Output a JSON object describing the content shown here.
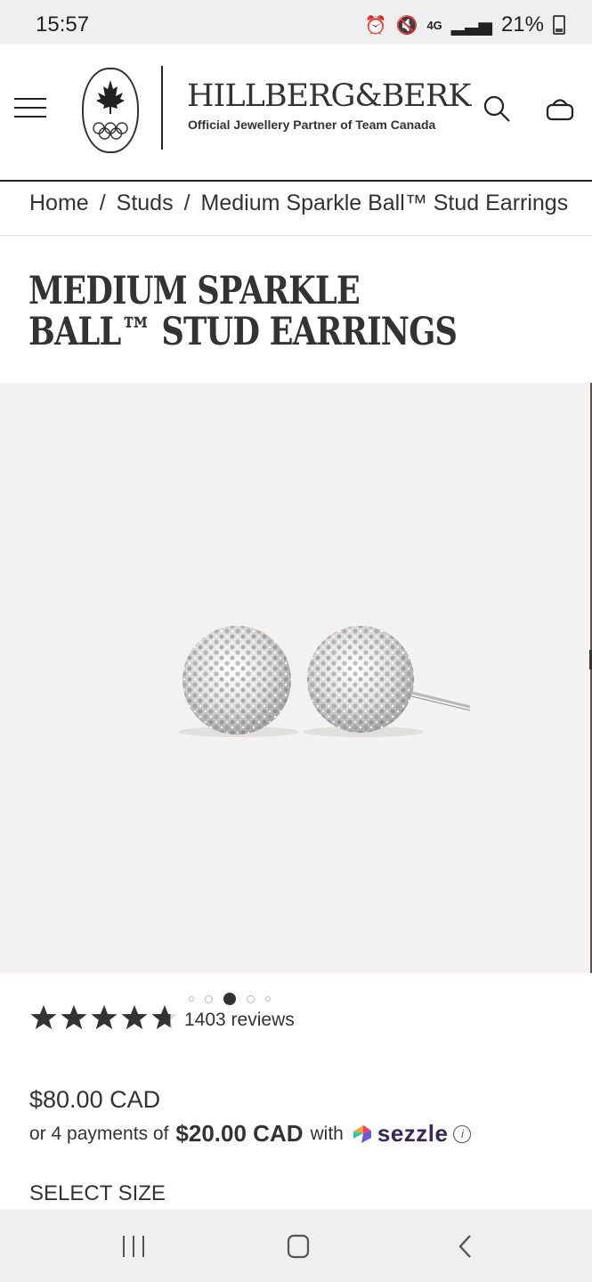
{
  "status_bar": {
    "time": "15:57",
    "network": "4G",
    "battery": "21%"
  },
  "header": {
    "brand_name": "HILLBERG&BERK",
    "brand_tagline": "Official Jewellery Partner of Team Canada"
  },
  "breadcrumb": {
    "items": [
      "Home",
      "Studs",
      "Medium Sparkle Ball™ Stud Earrings"
    ],
    "separator": "/"
  },
  "product": {
    "title": "MEDIUM SPARKLE BALL™ STUD EARRINGS",
    "rating": 4.7,
    "rating_max": 5,
    "reviews_label": "1403 reviews",
    "price": "$80.00 CAD",
    "installments_prefix": "or 4 payments of",
    "installment_amount": "$20.00 CAD",
    "installments_with": "with",
    "payment_provider": "sezzle",
    "select_size_label": "SELECT SIZE"
  },
  "gallery": {
    "slide_count": 5,
    "active_slide": 3
  },
  "colors": {
    "text": "#333333",
    "gallery_bg": "#f3f2f0",
    "sezzle_purple": "#382757"
  },
  "icons": [
    "menu-icon",
    "search-icon",
    "cart-icon",
    "star-icon",
    "info-icon",
    "nav-recents-icon",
    "nav-home-icon",
    "nav-back-icon"
  ]
}
